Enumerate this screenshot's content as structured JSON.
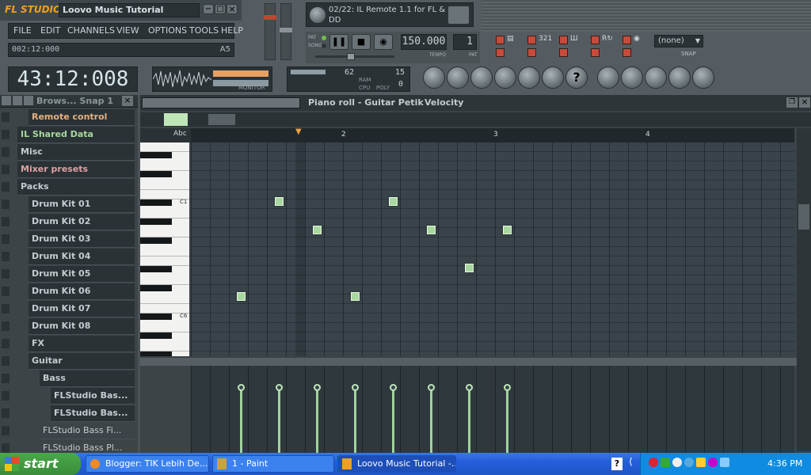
{
  "app": {
    "logo": "FL STUDIO",
    "window_title": "Loovo Music Tutorial",
    "minimize": "−",
    "maximize": "□",
    "close": "×"
  },
  "menu": [
    "FILE",
    "EDIT",
    "CHANNELS",
    "VIEW",
    "OPTIONS",
    "TOOLS",
    "HELP"
  ],
  "hint_bar": {
    "time": "002:12:000",
    "note": "A5"
  },
  "main_clock": "43:12:008",
  "monitor_label": "MONITOR",
  "cpu_panel": {
    "cpu": "62",
    "poly": "15",
    "ram": "0",
    "labels": [
      "RAM",
      "CPU",
      "POLY"
    ]
  },
  "song_panel": {
    "text": "02/22: IL Remote 1.1 for FL & DD"
  },
  "transport": {
    "pat_label": "PAT",
    "song_label": "SONG",
    "tempo": "150.000",
    "tempo_label": "TEMPO",
    "pattern": "1",
    "pattern_label": "PAT"
  },
  "snap": {
    "value": "(none)",
    "label": "SNAP"
  },
  "browser": {
    "header": "Brows...  Snap 1",
    "items": [
      {
        "label": "Remote control",
        "style": "orange",
        "indent": 1
      },
      {
        "label": "IL Shared Data",
        "style": "green",
        "indent": 0
      },
      {
        "label": "Misc",
        "style": "",
        "indent": 0
      },
      {
        "label": "Mixer presets",
        "style": "red",
        "indent": 0
      },
      {
        "label": "Packs",
        "style": "",
        "indent": 0
      },
      {
        "label": "Drum Kit 01",
        "style": "",
        "indent": 1
      },
      {
        "label": "Drum Kit 02",
        "style": "",
        "indent": 1
      },
      {
        "label": "Drum Kit 03",
        "style": "",
        "indent": 1
      },
      {
        "label": "Drum Kit 04",
        "style": "",
        "indent": 1
      },
      {
        "label": "Drum Kit 05",
        "style": "",
        "indent": 1
      },
      {
        "label": "Drum Kit 06",
        "style": "",
        "indent": 1
      },
      {
        "label": "Drum Kit 07",
        "style": "",
        "indent": 1
      },
      {
        "label": "Drum Kit 08",
        "style": "",
        "indent": 1
      },
      {
        "label": "FX",
        "style": "",
        "indent": 1
      },
      {
        "label": "Guitar",
        "style": "",
        "indent": 1
      },
      {
        "label": "Bass",
        "style": "",
        "indent": 2
      },
      {
        "label": "FLStudio Bas...",
        "style": "",
        "indent": 3
      },
      {
        "label": "FLStudio Bas...",
        "style": "",
        "indent": 3
      },
      {
        "label": "FLStudio Bass Fi...",
        "style": "file",
        "indent": 2
      },
      {
        "label": "FLStudio Bass Pl...",
        "style": "file",
        "indent": 2
      }
    ]
  },
  "piano_roll": {
    "title": "Piano roll - Guitar Petik",
    "param": "Velocity",
    "bars": [
      "2",
      "3",
      "4"
    ],
    "key_labels": [
      "C1",
      "C6"
    ],
    "tool_label": "Abc"
  },
  "notes": [
    {
      "bar_pos": 1.55,
      "row": 6
    },
    {
      "bar_pos": 2.3,
      "row": 6
    },
    {
      "bar_pos": 1.8,
      "row": 9
    },
    {
      "bar_pos": 2.55,
      "row": 9
    },
    {
      "bar_pos": 3.05,
      "row": 9
    },
    {
      "bar_pos": 2.8,
      "row": 13
    },
    {
      "bar_pos": 1.3,
      "row": 16
    },
    {
      "bar_pos": 2.05,
      "row": 16
    }
  ],
  "taskbar": {
    "start": "start",
    "tasks": [
      "Blogger: TIK Lebih De...",
      "1 - Paint",
      "Loovo Music Tutorial -..."
    ],
    "clock": "4:36 PM"
  }
}
